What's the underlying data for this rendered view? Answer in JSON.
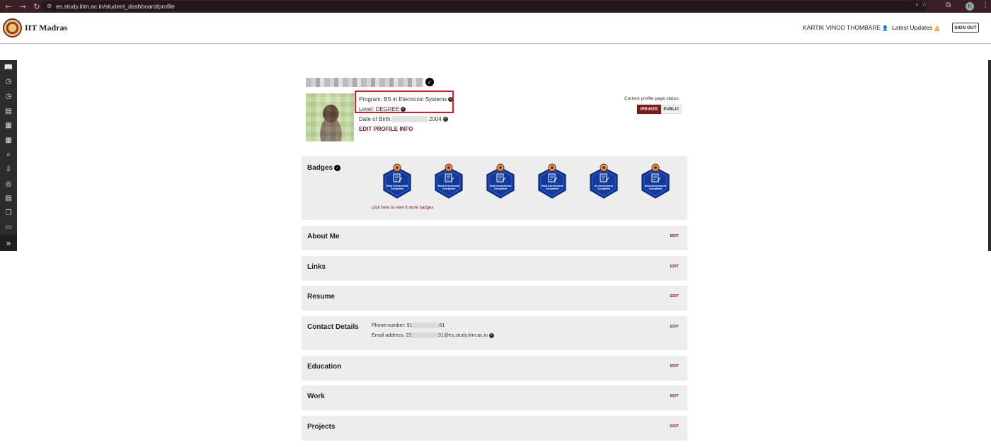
{
  "browser": {
    "url": "es.study.iitm.ac.in/student_dashboard/profile",
    "profile_initial": "K"
  },
  "header": {
    "brand": "IIT Madras",
    "user_name": "KARTIK VINOD THOMBARE",
    "latest_updates": "Latest Updates",
    "sign_out": "SIGN OUT"
  },
  "profile": {
    "program": "Program: BS in Electronic Systems",
    "level": "Level: DEGREE",
    "dob_label": "Date of Birth:",
    "dob_year": "2004",
    "edit_profile": "EDIT PROFILE INFO",
    "status_label": "Current profile page status:",
    "private_label": "PRIVATE",
    "public_label": "PUBLIC"
  },
  "badges": {
    "title": "Badges",
    "items": [
      {
        "text": "Most Assessment Completed"
      },
      {
        "text": "Most Assessment Completed"
      },
      {
        "text": "Most Assessment Completed"
      },
      {
        "text": "Most Assessment Completed"
      },
      {
        "text": "All Assessment Completed"
      },
      {
        "text": "Most Assessment Completed"
      }
    ],
    "more_link": "click here to view 6 more badges",
    "color": "#123a9c"
  },
  "sections": {
    "about": {
      "title": "About Me",
      "edit": "EDIT"
    },
    "links": {
      "title": "Links",
      "edit": "EDIT"
    },
    "resume": {
      "title": "Resume",
      "edit": "EDIT"
    },
    "contact": {
      "title": "Contact Details",
      "edit": "EDIT",
      "phone_label": "Phone number: 91",
      "phone_tail": "61",
      "email_label": "Email address: 23",
      "email_tail": "31@es.study.iitm.ac.in"
    },
    "education": {
      "title": "Education",
      "edit": "EDIT"
    },
    "work": {
      "title": "Work",
      "edit": "EDIT"
    },
    "projects": {
      "title": "Projects",
      "edit": "EDIT"
    }
  },
  "colors": {
    "accent": "#7a1b1b",
    "highlight": "#e0151b",
    "section_bg": "#ededed"
  }
}
